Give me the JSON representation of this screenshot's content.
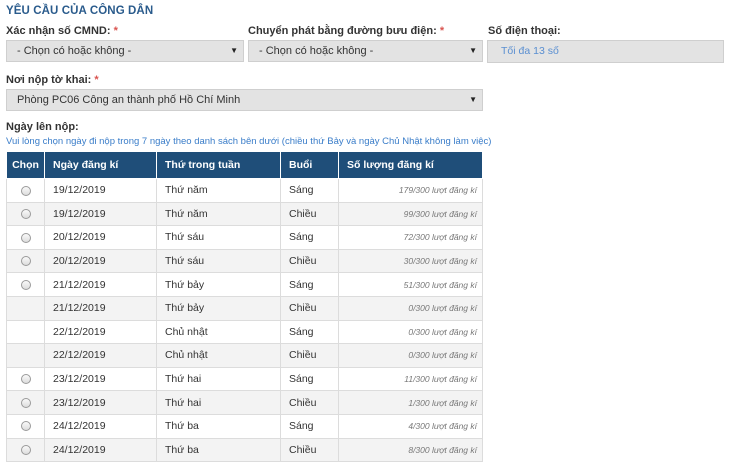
{
  "section_title": "YÊU CẦU CỦA CÔNG DÂN",
  "required_mark": "*",
  "cmnd": {
    "label": "Xác nhận số CMND:",
    "value": "- Chọn có hoặc không -"
  },
  "postal": {
    "label": "Chuyển phát bằng đường bưu điện:",
    "value": "- Chọn có hoặc không -"
  },
  "phone": {
    "label": "Số điện thoại:",
    "placeholder": "Tối đa 13 số"
  },
  "office": {
    "label": "Nơi nộp tờ khai:",
    "value": "Phòng PC06 Công an thành phố Hồ Chí Minh"
  },
  "date_section": {
    "label": "Ngày lên nộp:",
    "note": "Vui lòng chọn ngày đi nộp trong 7 ngày theo danh sách bên dưới (chiều thứ Bảy và ngày Chủ Nhật không làm việc)"
  },
  "table": {
    "headers": [
      "Chọn",
      "Ngày đăng kí",
      "Thứ trong tuần",
      "Buổi",
      "Số lượng đăng kí"
    ],
    "rows": [
      {
        "selectable": true,
        "date": "19/12/2019",
        "weekday": "Thứ năm",
        "session": "Sáng",
        "count": "179/300 lượt đăng kí"
      },
      {
        "selectable": true,
        "date": "19/12/2019",
        "weekday": "Thứ năm",
        "session": "Chiều",
        "count": "99/300 lượt đăng kí"
      },
      {
        "selectable": true,
        "date": "20/12/2019",
        "weekday": "Thứ sáu",
        "session": "Sáng",
        "count": "72/300 lượt đăng kí"
      },
      {
        "selectable": true,
        "date": "20/12/2019",
        "weekday": "Thứ sáu",
        "session": "Chiều",
        "count": "30/300 lượt đăng kí"
      },
      {
        "selectable": true,
        "date": "21/12/2019",
        "weekday": "Thứ bảy",
        "session": "Sáng",
        "count": "51/300 lượt đăng kí"
      },
      {
        "selectable": false,
        "date": "21/12/2019",
        "weekday": "Thứ bảy",
        "session": "Chiều",
        "count": "0/300 lượt đăng kí"
      },
      {
        "selectable": false,
        "date": "22/12/2019",
        "weekday": "Chủ nhật",
        "session": "Sáng",
        "count": "0/300 lượt đăng kí"
      },
      {
        "selectable": false,
        "date": "22/12/2019",
        "weekday": "Chủ nhật",
        "session": "Chiều",
        "count": "0/300 lượt đăng kí"
      },
      {
        "selectable": true,
        "date": "23/12/2019",
        "weekday": "Thứ hai",
        "session": "Sáng",
        "count": "11/300 lượt đăng kí"
      },
      {
        "selectable": true,
        "date": "23/12/2019",
        "weekday": "Thứ hai",
        "session": "Chiều",
        "count": "1/300 lượt đăng kí"
      },
      {
        "selectable": true,
        "date": "24/12/2019",
        "weekday": "Thứ ba",
        "session": "Sáng",
        "count": "4/300 lượt đăng kí"
      },
      {
        "selectable": true,
        "date": "24/12/2019",
        "weekday": "Thứ ba",
        "session": "Chiều",
        "count": "8/300 lượt đăng kí"
      }
    ]
  },
  "colors": {
    "header_bg": "#1f4e79",
    "title": "#2a5b8c",
    "required": "#d9534f",
    "link_note": "#3a7dc9"
  }
}
